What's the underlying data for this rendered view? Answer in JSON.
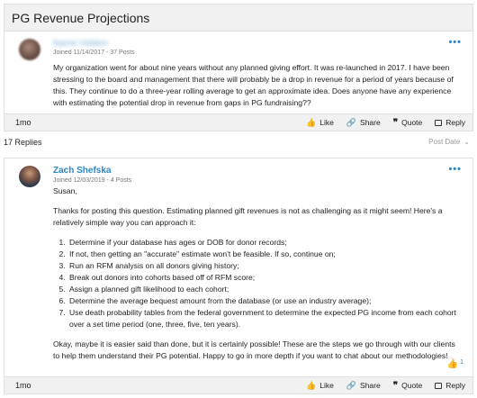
{
  "thread": {
    "title": "PG Revenue Projections"
  },
  "post1": {
    "author": "Name Hidden",
    "meta": "Joined 11/14/2017 - 37 Posts",
    "body": "My organization went for about nine years without any planned giving effort.  It was re-launched in 2017.  I have been stressing to the board and management that there will probably be a drop in revenue for a period of years because of this.  They continue to do a three-year rolling average to get an approximate idea.  Does anyone have any experience with estimating the potential drop in revenue from gaps in PG fundraising??",
    "age": "1mo"
  },
  "replies": {
    "count": "17 Replies",
    "sort_label": "Post Date"
  },
  "post2": {
    "author": "Zach Shefska",
    "meta": "Joined 12/03/2019 - 4 Posts",
    "greeting": "Susan,",
    "intro": "Thanks for posting this question. Estimating planned gift revenues is not as challenging as it might seem! Here's a relatively simple way you can approach it:",
    "steps": [
      "Determine if your database has ages or DOB for donor records;",
      "If not, then getting an \"accurate\" estimate won't be feasible. If so, continue on;",
      "Run an RFM analysis on all donors giving history;",
      "Break out donors into cohorts based off of RFM score;",
      "Assign a planned gift likelihood to each cohort;",
      "Determine the average bequest amount from the database (or use an industry average);",
      "Use death probability tables from the federal government to determine the expected PG income from each cohort over a set time period (one, three, five, ten years)."
    ],
    "closing": "Okay, maybe it is easier said than done, but it is certainly possible! These are the steps we go through with our clients to help them understand their PG potential. Happy to go in more depth if you want to chat about our methodologies!",
    "likes": "1",
    "age": "1mo"
  },
  "actions": {
    "like": "Like",
    "share": "Share",
    "quote": "Quote",
    "reply": "Reply"
  },
  "icons": {
    "more": "more-dots-icon",
    "like": "thumbs-up-icon",
    "share": "share-icon",
    "quote": "quote-icon",
    "reply": "reply-icon",
    "sort": "chevron-down-icon"
  },
  "colors": {
    "link": "#2b86c5",
    "like": "#e3a51b",
    "bar": "#f1f1f1"
  }
}
